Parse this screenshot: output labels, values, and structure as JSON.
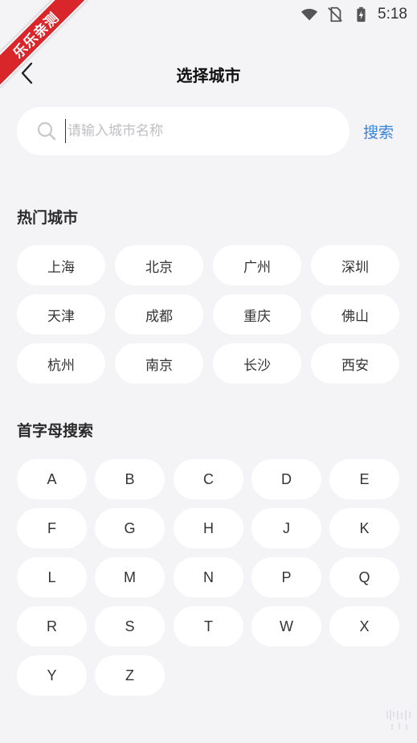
{
  "status_bar": {
    "time": "5:18",
    "icons": [
      "wifi-icon",
      "no-sim-icon",
      "battery-charging-icon"
    ]
  },
  "watermark": {
    "text": "乐乐亲测"
  },
  "header": {
    "title": "选择城市",
    "back_icon": "chevron-left-icon"
  },
  "search": {
    "placeholder": "请输入城市名称",
    "value": "",
    "button_label": "搜索",
    "icon": "search-icon"
  },
  "hot_cities": {
    "title": "热门城市",
    "items": [
      "上海",
      "北京",
      "广州",
      "深圳",
      "天津",
      "成都",
      "重庆",
      "佛山",
      "杭州",
      "南京",
      "长沙",
      "西安"
    ]
  },
  "letter_search": {
    "title": "首字母搜索",
    "letters": [
      "A",
      "B",
      "C",
      "D",
      "E",
      "F",
      "G",
      "H",
      "J",
      "K",
      "L",
      "M",
      "N",
      "P",
      "Q",
      "R",
      "S",
      "T",
      "W",
      "X",
      "Y",
      "Z"
    ]
  },
  "colors": {
    "background": "#f4f4f7",
    "accent": "#3a82d8",
    "ribbon": "#d8262b"
  }
}
